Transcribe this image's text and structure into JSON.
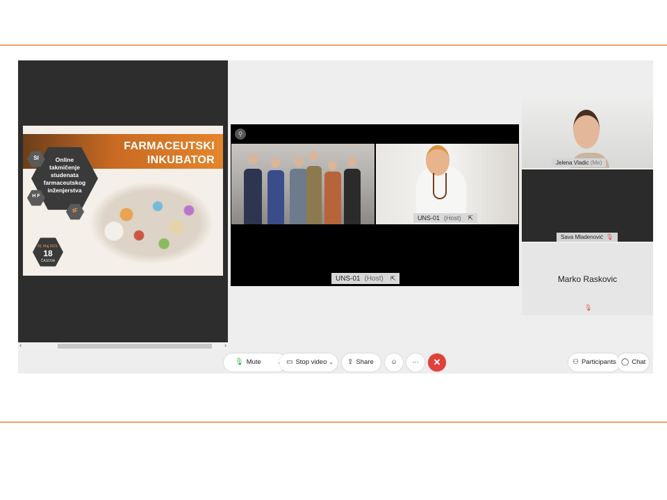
{
  "meeting": {
    "accent_color": "#e3a46c",
    "end_button_color": "#e0413a"
  },
  "shared_slide": {
    "title_line1": "FARMACEUTSKI",
    "title_line2": "INKUBATOR",
    "hex_text_lines": [
      "Online",
      "takmičenje",
      "studenata",
      "farmaceutskog",
      "inženjerstva"
    ],
    "logo1": "SI",
    "logo2": "H F",
    "logo3": "tF",
    "date_small": "26. Maj 2021.",
    "date_number": "18",
    "date_label": "ČASOVA"
  },
  "stage": {
    "pin_icon": "pin-icon",
    "host_video_name": "UNS-01",
    "host_video_role": "(Host)",
    "stage_name": "UNS-01",
    "stage_role": "(Host)"
  },
  "participants": [
    {
      "name": "Jelena Vladic",
      "suffix": "(Me)",
      "video": true
    },
    {
      "name": "Sava Mladenović",
      "muted": true,
      "video": true
    },
    {
      "name": "Marko Raskovic",
      "muted": true,
      "video": false
    }
  ],
  "controls": {
    "mute_label": "Mute",
    "stop_video_label": "Stop video",
    "share_label": "Share",
    "reactions_icon": "smiley-icon",
    "more_label": "···",
    "end_label": "✕",
    "participants_label": "Participants",
    "chat_label": "Chat"
  }
}
